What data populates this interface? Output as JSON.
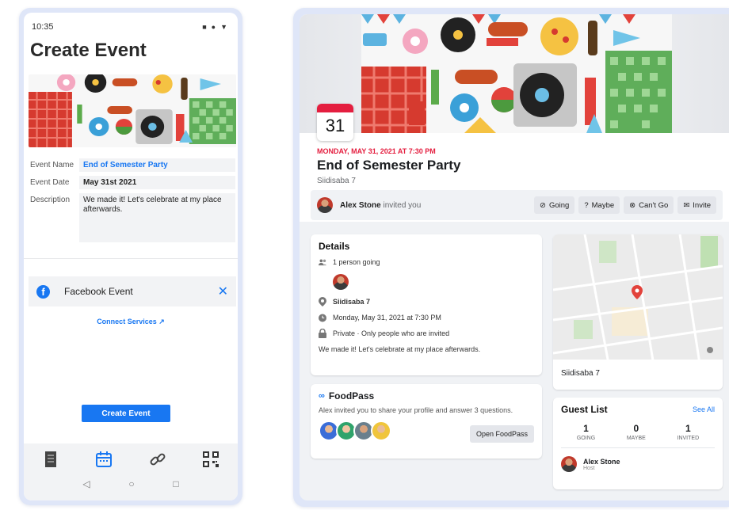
{
  "phone": {
    "status_time": "10:35",
    "title": "Create Event",
    "fields": {
      "name_label": "Event Name",
      "name_value": "End of Semester Party",
      "date_label": "Event Date",
      "date_value": "May 31st 2021",
      "desc_label": "Description",
      "desc_value": "We made it! Let's celebrate at my place afterwards."
    },
    "facebook_row": {
      "label": "Facebook Event",
      "close_icon": "close-icon"
    },
    "connect_link": "Connect Services",
    "create_button": "Create Event",
    "bottom_nav": [
      "document-icon",
      "calendar-icon",
      "link-icon",
      "qr-code-icon"
    ],
    "system_nav": [
      "back-icon",
      "home-icon",
      "recents-icon"
    ]
  },
  "tablet": {
    "calendar_day": "31",
    "date_line": "MONDAY, MAY 31, 2021 AT 7:30 PM",
    "title": "End of Semester Party",
    "location": "Siidisaba 7",
    "invite": {
      "inviter": "Alex Stone",
      "text": "invited you",
      "buttons": [
        "Going",
        "Maybe",
        "Can't Go",
        "Invite"
      ]
    },
    "details": {
      "heading": "Details",
      "going": "1 person going",
      "place": "Siidisaba 7",
      "datetime": "Monday, May 31, 2021 at 7:30 PM",
      "privacy": "Private · Only people who are invited",
      "description": "We made it! Let's celebrate at my place afterwards."
    },
    "map_label": "Siidisaba 7",
    "foodpass": {
      "title": "FoodPass",
      "subtitle": "Alex invited you to share your profile and answer 3 questions.",
      "button": "Open FoodPass"
    },
    "guests": {
      "heading": "Guest List",
      "see_all": "See All",
      "stats": [
        {
          "n": "1",
          "label": "GOING"
        },
        {
          "n": "0",
          "label": "MAYBE"
        },
        {
          "n": "1",
          "label": "INVITED"
        }
      ],
      "host_name": "Alex Stone",
      "host_role": "Host"
    }
  },
  "colors": {
    "accent": "#1877f2",
    "red": "#e41e3f",
    "frame": "#dfe6f8"
  }
}
